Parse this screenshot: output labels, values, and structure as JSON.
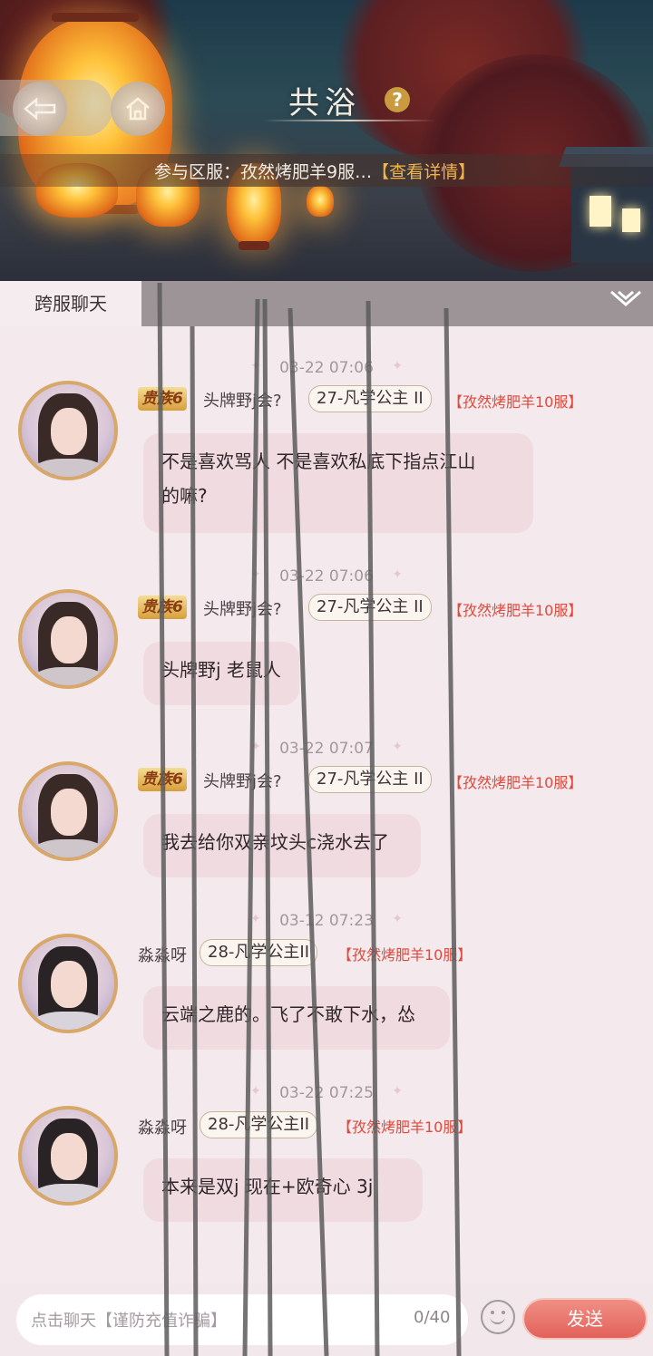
{
  "header": {
    "title": "共浴",
    "help_glyph": "?",
    "server_prefix": "参与区服：孜然烤肥羊9服…",
    "server_detail": "【查看详情】"
  },
  "tabs": {
    "active_label": "跨服聊天"
  },
  "messages": [
    {
      "time": "03-22 07:06",
      "noble": "贵族6",
      "username": "头牌野j会?",
      "title_badge": "27-凡学公主 II",
      "server": "【孜然烤肥羊10服】",
      "text_line1": "不是喜欢骂人 不是喜欢私底下指点江山",
      "text_line2": "的嘛?"
    },
    {
      "time": "03-22 07:06",
      "noble": "贵族6",
      "username": "头牌野j会?",
      "title_badge": "27-凡学公主 II",
      "server": "【孜然烤肥羊10服】",
      "text_line1": "头牌野j 老鼠人"
    },
    {
      "time": "03-22 07:07",
      "noble": "贵族6",
      "username": "头牌野j会?",
      "title_badge": "27-凡学公主 II",
      "server": "【孜然烤肥羊10服】",
      "text_line1": "我去给你双亲坟头c浇水去了"
    },
    {
      "time": "03-12 07:23",
      "username": "淼淼呀",
      "title_badge": "28-凡学公主II",
      "server": "【孜然烤肥羊10服】",
      "text_line1": "云端之鹿的。飞了不敢下水，怂"
    },
    {
      "time": "03-22 07:25",
      "username": "淼淼呀",
      "title_badge": "28-凡学公主II",
      "server": "【孜然烤肥羊10服】",
      "text_line1": "本来是双j 现在+欧奇心 3j"
    }
  ],
  "composer": {
    "placeholder": "点击聊天【谨防充值诈骗】",
    "counter": "0/40",
    "send_label": "发送"
  },
  "colors": {
    "accent_server": "#e0493b",
    "send_button": "#e2625a",
    "bubble": "#efdbe0",
    "background": "#f4e9ec"
  }
}
